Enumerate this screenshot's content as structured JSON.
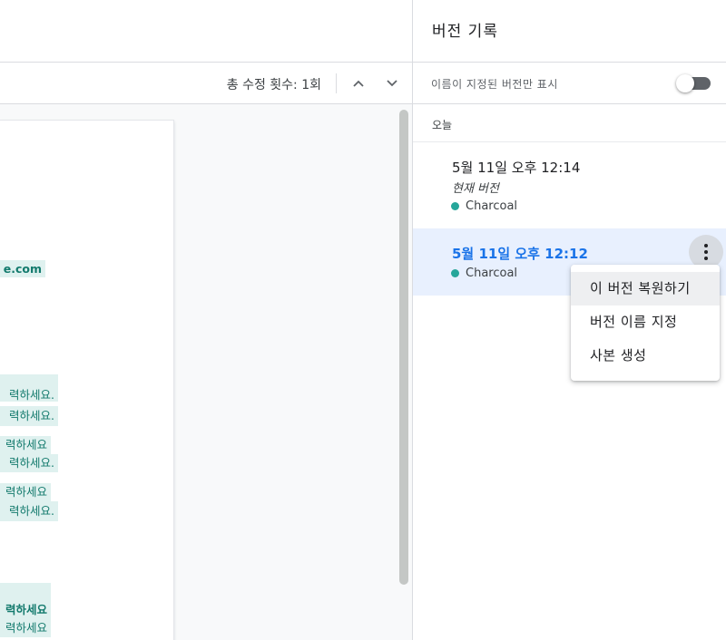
{
  "document": {
    "changes_count": "총 수정 횟수: 1회",
    "highlight_lines": [
      "e.com",
      "력하세요.",
      "력하세요.",
      "력하세요",
      "력하세요.",
      "력하세요",
      "력하세요.",
      "력하세요",
      "력하세요"
    ]
  },
  "panel": {
    "title": "버전 기록",
    "filter_label": "이름이 지정된 버전만 표시",
    "filter_on": false,
    "section_label": "오늘",
    "versions": [
      {
        "date": "5월 11일 오후 12:14",
        "status": "현재 버전",
        "author": "Charcoal",
        "author_color": "#26a69a"
      },
      {
        "date": "5월 11일 오후 12:12",
        "author": "Charcoal",
        "author_color": "#26a69a",
        "selected": true
      }
    ]
  },
  "menu": {
    "items": [
      "이 버전 복원하기",
      "버전 이름 지정",
      "사본 생성"
    ]
  },
  "icons": {
    "prev_change": "chevron-up-icon",
    "next_change": "chevron-down-icon",
    "more": "more-vert-icon"
  },
  "colors": {
    "accent": "#1a73e8",
    "highlight": "#dff1ef",
    "highlight_text": "#137a6d",
    "selected_bg": "#e8f0fe"
  }
}
